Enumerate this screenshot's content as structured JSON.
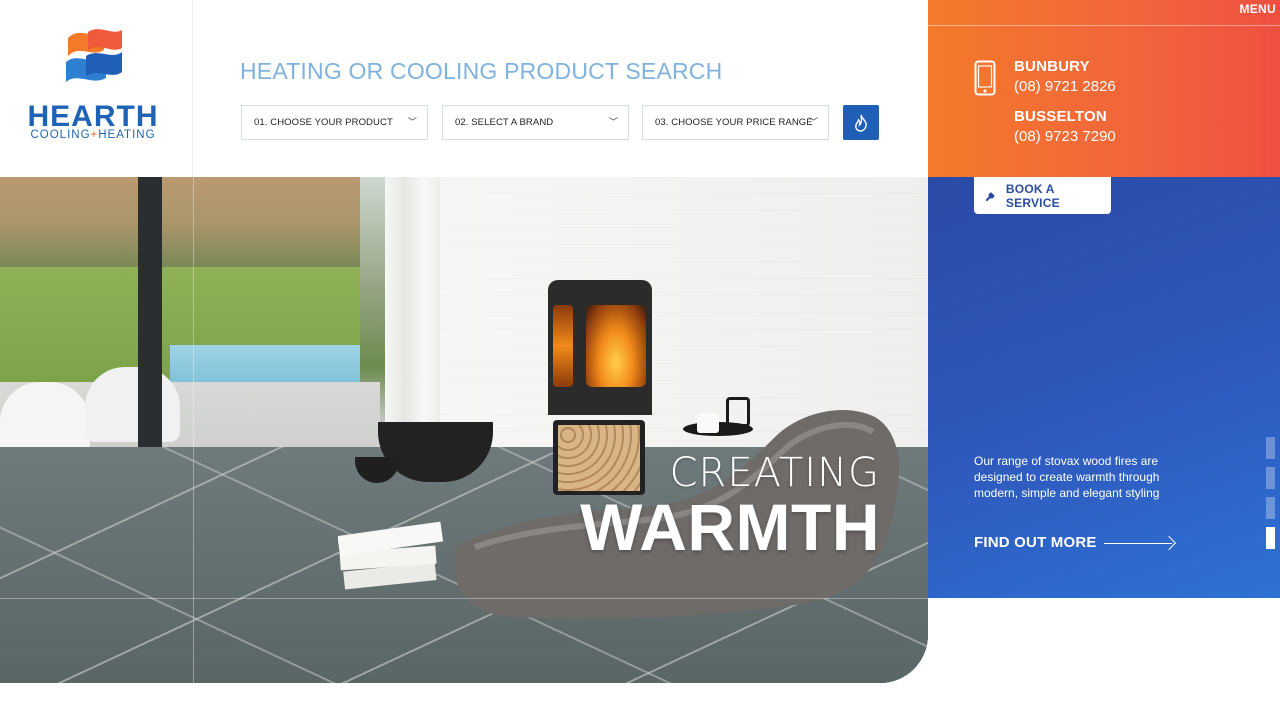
{
  "brand": {
    "name": "HEARTH",
    "tagline_a": "COOLING",
    "tagline_plus": "+",
    "tagline_b": "HEATING",
    "colors": {
      "blue": "#1e63b6",
      "orange": "#f26b2b"
    }
  },
  "search": {
    "title": "HEATING OR COOLING PRODUCT SEARCH",
    "product_select": "01. CHOOSE YOUR PRODUCT",
    "brand_select": "02. SELECT A BRAND",
    "price_select": "03. CHOOSE YOUR PRICE RANGE",
    "chevron_glyph": "⌄",
    "submit_icon": "flame-icon"
  },
  "contact": {
    "menu_label": "MENU",
    "locations": [
      {
        "city": "BUNBURY",
        "phone": "(08) 9721 2826"
      },
      {
        "city": "BUSSELTON",
        "phone": "(08) 9723 7290"
      }
    ],
    "icon": "mobile-phone-icon"
  },
  "hero": {
    "line1": "CREATING",
    "line2": "WARMTH",
    "book_label": "BOOK A SERVICE",
    "book_icon": "wrench-icon",
    "blurb": "Our range of stovax wood fires are designed to create warmth through modern, simple and elegant styling",
    "cta_label": "FIND OUT MORE",
    "slides": {
      "count": 4,
      "active_index": 3
    }
  }
}
